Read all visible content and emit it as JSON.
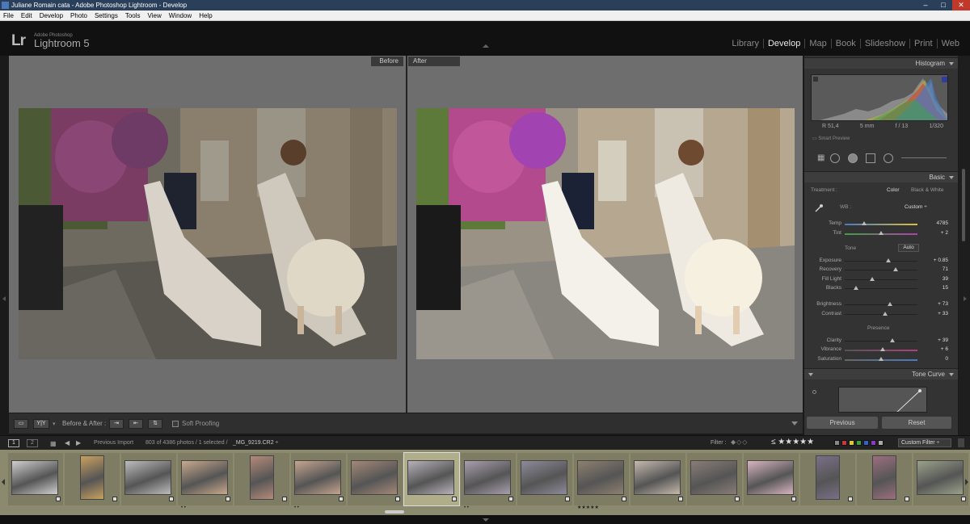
{
  "window": {
    "title": "Juliane Romain cata - Adobe Photoshop Lightroom - Develop"
  },
  "menu": [
    "File",
    "Edit",
    "Develop",
    "Photo",
    "Settings",
    "Tools",
    "View",
    "Window",
    "Help"
  ],
  "identity": {
    "logo": "Lr",
    "brand_small": "Adobe Photoshop",
    "brand_big": "Lightroom 5"
  },
  "modules": [
    "Library",
    "Develop",
    "Map",
    "Book",
    "Slideshow",
    "Print",
    "Web"
  ],
  "active_module": "Develop",
  "compare": {
    "before_label": "Before",
    "after_label": "After"
  },
  "toolbar": {
    "yy_label": "Y|Y",
    "before_after_label": "Before & After :",
    "soft_proofing": "Soft Proofing"
  },
  "histogram": {
    "title": "Histogram",
    "info": [
      "R 51,4",
      "5 mm",
      "f / 13",
      "1/320"
    ],
    "smart_preview": "Smart Preview"
  },
  "basic": {
    "title": "Basic",
    "treatment_label": "Treatment :",
    "treatment_color": "Color",
    "treatment_bw": "Black & White",
    "wb_label": "WB :",
    "wb_value": "Custom ÷",
    "tone_label": "Tone",
    "auto_label": "Auto",
    "presence_label": "Presence",
    "sliders": [
      {
        "label": "Temp",
        "value": "4785",
        "pos": 0.27
      },
      {
        "label": "Tint",
        "value": "+ 2",
        "pos": 0.5
      },
      {
        "label": "Exposure",
        "value": "+ 0.85",
        "pos": 0.6
      },
      {
        "label": "Recovery",
        "value": "71",
        "pos": 0.7
      },
      {
        "label": "Fill Light",
        "value": "39",
        "pos": 0.38
      },
      {
        "label": "Blacks",
        "value": "15",
        "pos": 0.15
      },
      {
        "label": "Brightness",
        "value": "+ 73",
        "pos": 0.62
      },
      {
        "label": "Contrast",
        "value": "+ 33",
        "pos": 0.55
      },
      {
        "label": "Clarity",
        "value": "+ 39",
        "pos": 0.65
      },
      {
        "label": "Vibrance",
        "value": "+ 6",
        "pos": 0.52
      },
      {
        "label": "Saturation",
        "value": "0",
        "pos": 0.5
      }
    ]
  },
  "tone_curve": {
    "title": "Tone Curve"
  },
  "buttons": {
    "previous": "Previous",
    "reset": "Reset"
  },
  "filmbar": {
    "page1": "1",
    "page2": "2",
    "source": "Previous Import",
    "count": "803 of 4386 photos / 1 selected /",
    "file": "_MG_9219.CR2 ÷",
    "filter_label": "Filter :",
    "stars": "≤ ★★★★★",
    "custom_filter": "Custom Filter ÷"
  },
  "colors": {
    "accent": "#e8e8e8",
    "panel": "#333333",
    "filmstrip": "#8c8a6e"
  },
  "filmstrip": {
    "thumbs": [
      {
        "shape": "landscape",
        "tone": "#cfcfcf",
        "stars": ""
      },
      {
        "shape": "portrait",
        "tone": "#c8a060",
        "stars": ""
      },
      {
        "shape": "landscape",
        "tone": "#bdbdbd",
        "stars": ""
      },
      {
        "shape": "landscape",
        "tone": "#c9a98c",
        "stars": "• •"
      },
      {
        "shape": "portrait",
        "tone": "#b58a7a",
        "stars": ""
      },
      {
        "shape": "landscape",
        "tone": "#c6a58e",
        "stars": "• •"
      },
      {
        "shape": "landscape",
        "tone": "#a48878",
        "stars": ""
      },
      {
        "shape": "landscape",
        "tone": "#b7b2ba",
        "stars": "",
        "selected": true
      },
      {
        "shape": "landscape",
        "tone": "#a99fae",
        "stars": "• •"
      },
      {
        "shape": "landscape",
        "tone": "#8d8b9a",
        "stars": ""
      },
      {
        "shape": "landscape",
        "tone": "#8e8070",
        "stars": "★★★★★"
      },
      {
        "shape": "landscape",
        "tone": "#c5b9ad",
        "stars": ""
      },
      {
        "shape": "landscape",
        "tone": "#8a7d76",
        "stars": ""
      },
      {
        "shape": "landscape",
        "tone": "#d8b5c0",
        "stars": ""
      },
      {
        "shape": "portrait",
        "tone": "#7a6f88",
        "stars": ""
      },
      {
        "shape": "portrait",
        "tone": "#9b6f7e",
        "stars": ""
      },
      {
        "shape": "landscape",
        "tone": "#9aa28a",
        "stars": ""
      }
    ]
  }
}
